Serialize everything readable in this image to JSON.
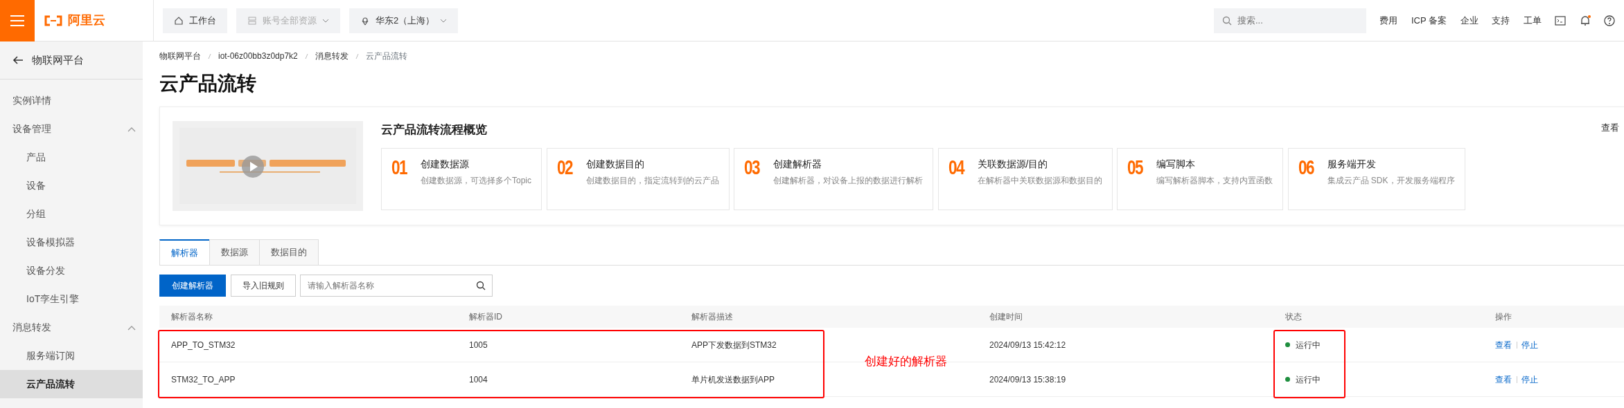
{
  "topbar": {
    "logo": "阿里云",
    "nav": [
      {
        "label": "工作台",
        "kind": "home",
        "disabled": false,
        "dropdown": false
      },
      {
        "label": "账号全部资源",
        "kind": "resources",
        "disabled": true,
        "dropdown": true
      },
      {
        "label": "华东2（上海）",
        "kind": "region",
        "disabled": false,
        "dropdown": true
      }
    ],
    "search": {
      "placeholder": "搜索..."
    },
    "links": [
      "费用",
      "ICP 备案",
      "企业",
      "支持",
      "工单"
    ],
    "notification_dot": true
  },
  "sidebar": {
    "back": "物联网平台",
    "items": [
      {
        "label": "实例详情",
        "kind": "link",
        "selected": false
      },
      {
        "label": "设备管理",
        "kind": "group",
        "expanded": true,
        "selected": false,
        "children": [
          {
            "label": "产品",
            "selected": false
          },
          {
            "label": "设备",
            "selected": false
          },
          {
            "label": "分组",
            "selected": false
          },
          {
            "label": "设备模拟器",
            "selected": false
          },
          {
            "label": "设备分发",
            "selected": false
          },
          {
            "label": "IoT孪生引擎",
            "selected": false
          }
        ]
      },
      {
        "label": "消息转发",
        "kind": "group",
        "expanded": true,
        "selected": false,
        "children": [
          {
            "label": "服务端订阅",
            "selected": false
          },
          {
            "label": "云产品流转",
            "selected": true
          }
        ]
      }
    ]
  },
  "breadcrumb": [
    "物联网平台",
    "iot-06z00bb3z0dp7k2",
    "消息转发",
    "云产品流转"
  ],
  "page_title": "云产品流转",
  "overview": {
    "title": "云产品流转流程概览",
    "more_link": "查看",
    "steps": [
      {
        "number": "01",
        "title": "创建数据源",
        "description": "创建数据源，可选择多个Topic"
      },
      {
        "number": "02",
        "title": "创建数据目的",
        "description": "创建数据目的，指定流转到的云产品"
      },
      {
        "number": "03",
        "title": "创建解析器",
        "description": "创建解析器，对设备上报的数据进行解析"
      },
      {
        "number": "04",
        "title": "关联数据源/目的",
        "description": "在解析器中关联数据源和数据目的"
      },
      {
        "number": "05",
        "title": "编写脚本",
        "description": "编写解析器脚本，支持内置函数"
      },
      {
        "number": "06",
        "title": "服务端开发",
        "description": "集成云产品 SDK，开发服务端程序"
      }
    ]
  },
  "tabs": [
    {
      "label": "解析器",
      "selected": true
    },
    {
      "label": "数据源",
      "selected": false
    },
    {
      "label": "数据目的",
      "selected": false
    }
  ],
  "toolbar": {
    "buttons": [
      {
        "label": "创建解析器",
        "kind": "primary"
      },
      {
        "label": "导入旧规则",
        "kind": "secondary"
      }
    ],
    "search": {
      "placeholder": "请输入解析器名称"
    }
  },
  "table": {
    "columns": [
      "解析器名称",
      "解析器ID",
      "解析器描述",
      "创建时间",
      "状态",
      "操作"
    ],
    "rows": [
      {
        "name": "APP_TO_STM32",
        "id": "1005",
        "description": "APP下发数据到STM32",
        "created": "2024/09/13 15:42:12",
        "status": {
          "label": "运行中",
          "color": "#1e8e3e"
        },
        "actions": [
          "查看",
          "停止"
        ]
      },
      {
        "name": "STM32_TO_APP",
        "id": "1004",
        "description": "单片机发送数据到APP",
        "created": "2024/09/13 15:38:19",
        "status": {
          "label": "运行中",
          "color": "#1e8e3e"
        },
        "actions": [
          "查看",
          "停止"
        ]
      }
    ]
  },
  "annotation": {
    "text": "创建好的解析器"
  }
}
